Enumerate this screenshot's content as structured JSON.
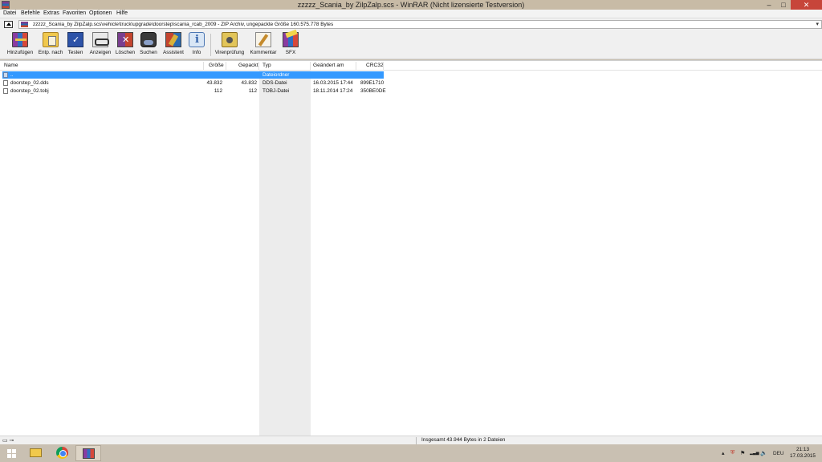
{
  "window": {
    "title": "zzzzz_Scania_by ZilpZalp.scs - WinRAR (Nicht lizensierte Testversion)",
    "minimize": "–",
    "maximize": "□",
    "close": "✕"
  },
  "menu": [
    "Datei",
    "Befehle",
    "Extras",
    "Favoriten",
    "Optionen",
    "Hilfe"
  ],
  "path": {
    "text": "zzzzz_Scania_by ZilpZalp.scs\\vehicle\\truck\\upgrade\\doorstep\\scania_rcab_2009 - ZIP Archiv, ungepackte Größe 160.575.778 Bytes",
    "dropdown": "▾"
  },
  "toolbar": [
    {
      "label": "Hinzufügen",
      "icon": "add-archive-icon"
    },
    {
      "label": "Entp. nach",
      "icon": "extract-to-icon"
    },
    {
      "label": "Testen",
      "icon": "test-icon"
    },
    {
      "label": "Anzeigen",
      "icon": "view-icon"
    },
    {
      "label": "Löschen",
      "icon": "delete-icon"
    },
    {
      "label": "Suchen",
      "icon": "find-icon"
    },
    {
      "label": "Assistent",
      "icon": "wizard-icon"
    },
    {
      "label": "Info",
      "icon": "info-icon"
    },
    {
      "label": "Virenprüfung",
      "icon": "virus-scan-icon"
    },
    {
      "label": "Kommentar",
      "icon": "comment-icon"
    },
    {
      "label": "SFX",
      "icon": "sfx-icon"
    }
  ],
  "columns": [
    "Name",
    "Größe",
    "Gepackt",
    "Typ",
    "Geändert am",
    "CRC32"
  ],
  "rows": [
    {
      "name": "..",
      "size": "",
      "packed": "",
      "type": "Dateiordner",
      "modified": "",
      "crc": ""
    },
    {
      "name": "doorstep_02.dds",
      "size": "43.832",
      "packed": "43.832",
      "type": "DDS-Datei",
      "modified": "16.03.2015 17:44",
      "crc": "899E1710"
    },
    {
      "name": "doorstep_02.tobj",
      "size": "112",
      "packed": "112",
      "type": "TOBJ-Datei",
      "modified": "18.11.2014 17:24",
      "crc": "350BE0DE"
    }
  ],
  "status": {
    "icons": "▭ ⊸",
    "text": "Insgesamt 43.944 Bytes in 2 Dateien"
  },
  "taskbar": {
    "tray": {
      "chevron": "▴",
      "shield": "⛨",
      "flag": "⚑",
      "signal": "▂▃▅",
      "volume": "🔈",
      "language": "DEU"
    },
    "time": "21:13",
    "date": "17.03.2015"
  },
  "colors": {
    "selection": "#3399ff",
    "taskbar": "#c9c0b2",
    "close_button": "#c7453a"
  }
}
